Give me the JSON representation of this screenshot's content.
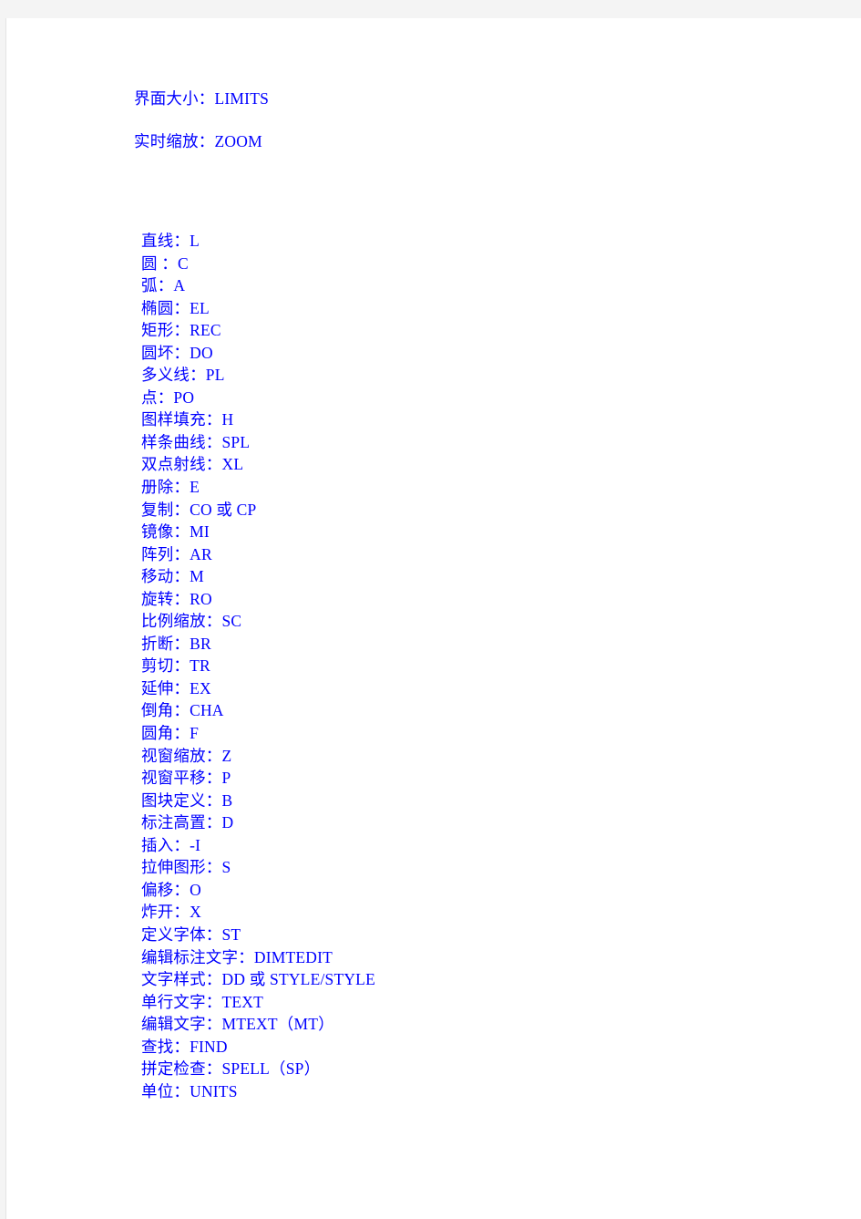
{
  "document": {
    "page_background": "#ffffff",
    "viewer_background": "#f4f4f4",
    "text_color": "#0000ff",
    "intro_lines": [
      "界面大小：LIMITS",
      "实时缩放：ZOOM"
    ],
    "commands": [
      "直线：L",
      "圆 ：C",
      "弧：A",
      "椭圆：EL",
      "矩形：REC",
      "圆坏：DO",
      "多义线：PL",
      "点：PO",
      "图样填充：H",
      "样条曲线：SPL",
      "双点射线：XL",
      "册除：E",
      "复制：CO 或 CP",
      "镜像：MI",
      "阵列：AR",
      "移动：M",
      "旋转：RO",
      "比例缩放：SC",
      "折断：BR",
      "剪切：TR",
      "延伸：EX",
      "倒角：CHA",
      "圆角：F",
      "视窗缩放：Z",
      "视窗平移：P",
      "图块定义：B",
      "标注高置：D",
      "插入：-I",
      "拉伸图形：S",
      "偏移：O",
      "炸开：X",
      "定义字体：ST",
      "编辑标注文字：DIMTEDIT",
      "文字样式：DD 或 STYLE/STYLE",
      "单行文字：TEXT",
      "编辑文字：MTEXT（MT）",
      "查找：FIND",
      "拼定检查：SPELL（SP）",
      "单位：UNITS"
    ]
  }
}
